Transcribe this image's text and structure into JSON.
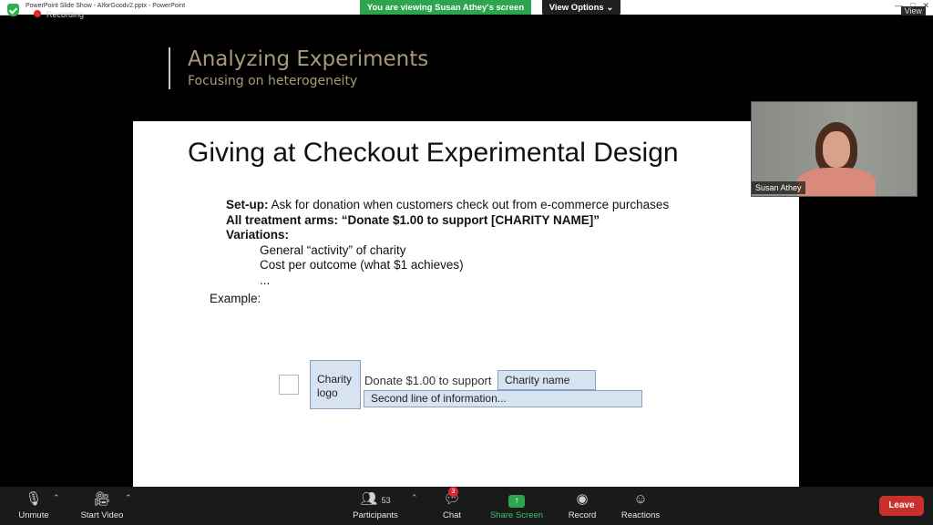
{
  "window": {
    "title": "PowerPoint Slide Show  -  AIforGoodv2.pptx  -  PowerPoint",
    "recording_label": "Recording",
    "viewing_banner": "You are viewing Susan Athey's screen",
    "view_options": "View Options",
    "view_label": "View"
  },
  "slide_header": {
    "title": "Analyzing Experiments",
    "subtitle": "Focusing on heterogeneity"
  },
  "slide": {
    "heading": "Giving at Checkout Experimental Design",
    "setup_label": "Set-up:",
    "setup_text": " Ask for donation when customers check out from e-commerce purchases",
    "treatment_line": "All treatment arms: “Donate $1.00 to support [CHARITY NAME]”",
    "variations_label": "Variations:",
    "variations": [
      "General “activity” of charity",
      "Cost per outcome (what $1 achieves)",
      "..."
    ],
    "example_label": "Example:",
    "mock": {
      "logo_line1": "Charity",
      "logo_line2": "logo",
      "donate_text": "Donate $1.00 to support",
      "charity_name": "Charity name",
      "second_line": "Second line of information..."
    }
  },
  "participant_video": {
    "name": "Susan Athey"
  },
  "toolbar": {
    "unmute": "Unmute",
    "start_video": "Start Video",
    "participants": "Participants",
    "participants_count": "53",
    "chat": "Chat",
    "chat_badge": "3",
    "share_screen": "Share Screen",
    "record": "Record",
    "reactions": "Reactions",
    "leave": "Leave"
  },
  "colors": {
    "green_banner": "#2da44e",
    "leave_red": "#c9302c",
    "title_gold": "#a89a78",
    "mock_fill": "#d7e3f1"
  }
}
